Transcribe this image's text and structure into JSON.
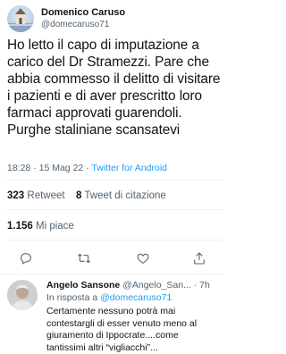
{
  "tweet": {
    "author_name": "Domenico Caruso",
    "author_handle": "@domecaruso71",
    "text": "Ho letto il capo di imputazione a carico del Dr Stramezzi. Pare che abbia commesso il delitto di visitare i pazienti e di aver prescritto loro farmaci approvati guarendoli. Purghe staliniane scansatevi",
    "time": "18:28",
    "date": "15 Mag 22",
    "separator": "·",
    "source": "Twitter for Android",
    "retweets_count": "323",
    "retweets_label": "Retweet",
    "quotes_count": "8",
    "quotes_label": "Tweet di citazione",
    "likes_count": "1.156",
    "likes_label": "Mi piace"
  },
  "actions": [
    {
      "icon": "reply-icon"
    },
    {
      "icon": "retweet-icon"
    },
    {
      "icon": "like-icon"
    },
    {
      "icon": "share-icon"
    }
  ],
  "reply": {
    "author_name": "Angelo Sansone",
    "author_handle": "@Angelo_San...",
    "time_sep": "·",
    "time": "7h",
    "in_reply_label": "In risposta a",
    "in_reply_handle": "@domecaruso71",
    "text": "Certamente nessuno potrà mai contestargli di esser venuto meno al giuramento di Ippocrate....come tantissimi altri “vigliacchi”..."
  },
  "colors": {
    "accent": "#1d9bf0",
    "secondary_text": "#536471",
    "primary_text": "#0f1419",
    "divider": "#eff3f4"
  }
}
